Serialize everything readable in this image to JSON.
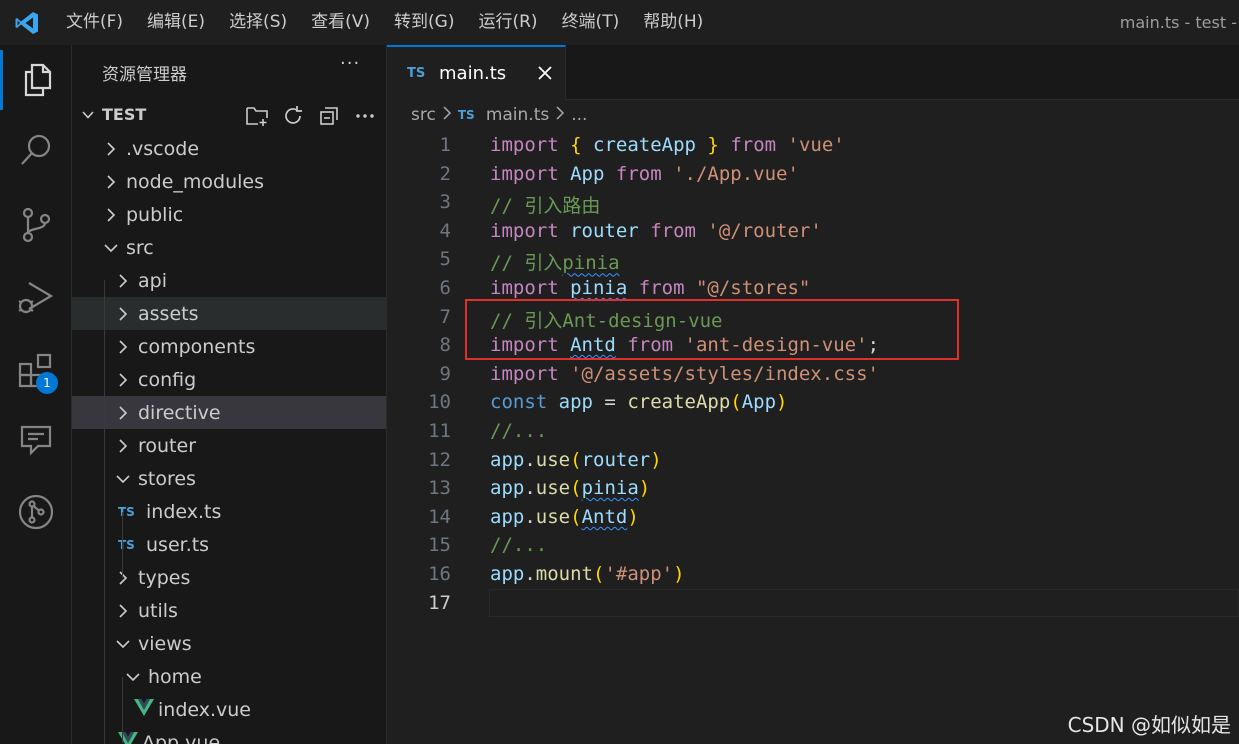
{
  "menu": [
    "文件(F)",
    "编辑(E)",
    "选择(S)",
    "查看(V)",
    "转到(G)",
    "运行(R)",
    "终端(T)",
    "帮助(H)"
  ],
  "window_title": "main.ts - test - V",
  "activity_bar": {
    "items": [
      "explorer",
      "search",
      "source-control",
      "run-debug",
      "extensions",
      "remote-explorer",
      "git-graph"
    ],
    "extensions_badge": "1"
  },
  "explorer": {
    "title": "资源管理器",
    "more": "···",
    "section": "TEST",
    "tree": [
      {
        "label": ".vscode",
        "kind": "folder",
        "open": false,
        "depth": 0
      },
      {
        "label": "node_modules",
        "kind": "folder",
        "open": false,
        "depth": 0
      },
      {
        "label": "public",
        "kind": "folder",
        "open": false,
        "depth": 0
      },
      {
        "label": "src",
        "kind": "folder",
        "open": true,
        "depth": 0
      },
      {
        "label": "api",
        "kind": "folder",
        "open": false,
        "depth": 1
      },
      {
        "label": "assets",
        "kind": "folder",
        "open": false,
        "depth": 1
      },
      {
        "label": "components",
        "kind": "folder",
        "open": false,
        "depth": 1
      },
      {
        "label": "config",
        "kind": "folder",
        "open": false,
        "depth": 1
      },
      {
        "label": "directive",
        "kind": "folder",
        "open": false,
        "depth": 1
      },
      {
        "label": "router",
        "kind": "folder",
        "open": false,
        "depth": 1
      },
      {
        "label": "stores",
        "kind": "folder",
        "open": true,
        "depth": 1
      },
      {
        "label": "index.ts",
        "kind": "ts",
        "depth": 2
      },
      {
        "label": "user.ts",
        "kind": "ts",
        "depth": 2
      },
      {
        "label": "types",
        "kind": "folder",
        "open": false,
        "depth": 1
      },
      {
        "label": "utils",
        "kind": "folder",
        "open": false,
        "depth": 1
      },
      {
        "label": "views",
        "kind": "folder",
        "open": true,
        "depth": 1
      },
      {
        "label": "home",
        "kind": "folder",
        "open": true,
        "depth": 2
      },
      {
        "label": "index.vue",
        "kind": "vue",
        "depth": 3
      },
      {
        "label": "App.vue",
        "kind": "vue",
        "depth": 1
      }
    ]
  },
  "tab": {
    "icon": "TS",
    "label": "main.ts"
  },
  "breadcrumb": {
    "folder": "src",
    "icon": "TS",
    "file": "main.ts",
    "more": "..."
  },
  "code_lines": [
    {
      "n": "1",
      "tokens": [
        [
          "import",
          "kw"
        ],
        [
          " ",
          "pl"
        ],
        [
          "{",
          "br1"
        ],
        [
          " ",
          "pl"
        ],
        [
          "createApp",
          "var"
        ],
        [
          " ",
          "pl"
        ],
        [
          "}",
          "br1"
        ],
        [
          " ",
          "pl"
        ],
        [
          "from",
          "kw"
        ],
        [
          " ",
          "pl"
        ],
        [
          "'vue'",
          "str"
        ]
      ]
    },
    {
      "n": "2",
      "tokens": [
        [
          "import",
          "kw"
        ],
        [
          " ",
          "pl"
        ],
        [
          "App",
          "var"
        ],
        [
          " ",
          "pl"
        ],
        [
          "from",
          "kw"
        ],
        [
          " ",
          "pl"
        ],
        [
          "'./App.vue'",
          "str"
        ]
      ]
    },
    {
      "n": "3",
      "tokens": [
        [
          "// 引入路由",
          "cmt"
        ]
      ]
    },
    {
      "n": "4",
      "tokens": [
        [
          "import",
          "kw"
        ],
        [
          " ",
          "pl"
        ],
        [
          "router",
          "var"
        ],
        [
          " ",
          "pl"
        ],
        [
          "from",
          "kw"
        ],
        [
          " ",
          "pl"
        ],
        [
          "'@/router'",
          "str"
        ]
      ]
    },
    {
      "n": "5",
      "tokens": [
        [
          "// 引入",
          "cmt"
        ],
        [
          "pinia",
          "cmt sq"
        ]
      ]
    },
    {
      "n": "6",
      "tokens": [
        [
          "import",
          "kw"
        ],
        [
          " ",
          "pl"
        ],
        [
          "pinia",
          "var sq"
        ],
        [
          " ",
          "pl"
        ],
        [
          "from",
          "kw"
        ],
        [
          " ",
          "pl"
        ],
        [
          "\"@/stores\"",
          "str"
        ]
      ]
    },
    {
      "n": "7",
      "tokens": [
        [
          "// 引入Ant-design-vue",
          "cmt"
        ]
      ]
    },
    {
      "n": "8",
      "tokens": [
        [
          "import",
          "kw"
        ],
        [
          " ",
          "pl"
        ],
        [
          "Antd",
          "var sq"
        ],
        [
          " ",
          "pl"
        ],
        [
          "from",
          "kw"
        ],
        [
          " ",
          "pl"
        ],
        [
          "'ant-design-vue'",
          "str"
        ],
        [
          ";",
          "pl"
        ]
      ]
    },
    {
      "n": "9",
      "tokens": [
        [
          "import",
          "kw"
        ],
        [
          " ",
          "pl"
        ],
        [
          "'@/assets/styles/index.css'",
          "str"
        ]
      ]
    },
    {
      "n": "10",
      "tokens": [
        [
          "const",
          "kwb"
        ],
        [
          " ",
          "pl"
        ],
        [
          "app",
          "var"
        ],
        [
          " = ",
          "pl"
        ],
        [
          "createApp",
          "fn"
        ],
        [
          "(",
          "br1"
        ],
        [
          "App",
          "var"
        ],
        [
          ")",
          "br1"
        ]
      ]
    },
    {
      "n": "11",
      "tokens": [
        [
          "//...",
          "cmt"
        ]
      ]
    },
    {
      "n": "12",
      "tokens": [
        [
          "app",
          "var"
        ],
        [
          ".",
          "pl"
        ],
        [
          "use",
          "fn"
        ],
        [
          "(",
          "br1"
        ],
        [
          "router",
          "var"
        ],
        [
          ")",
          "br1"
        ]
      ]
    },
    {
      "n": "13",
      "tokens": [
        [
          "app",
          "var"
        ],
        [
          ".",
          "pl"
        ],
        [
          "use",
          "fn"
        ],
        [
          "(",
          "br1"
        ],
        [
          "pinia",
          "var sq"
        ],
        [
          ")",
          "br1"
        ]
      ]
    },
    {
      "n": "14",
      "tokens": [
        [
          "app",
          "var"
        ],
        [
          ".",
          "pl"
        ],
        [
          "use",
          "fn"
        ],
        [
          "(",
          "br1"
        ],
        [
          "Antd",
          "var sq"
        ],
        [
          ")",
          "br1"
        ]
      ]
    },
    {
      "n": "15",
      "tokens": [
        [
          "//...",
          "cmt"
        ]
      ]
    },
    {
      "n": "16",
      "tokens": [
        [
          "app",
          "var"
        ],
        [
          ".",
          "pl"
        ],
        [
          "mount",
          "fn"
        ],
        [
          "(",
          "br1"
        ],
        [
          "'#app'",
          "str"
        ],
        [
          ")",
          "br1"
        ]
      ]
    },
    {
      "n": "17",
      "tokens": []
    }
  ],
  "current_line": "17",
  "highlight_box_color": "#e0302e",
  "watermark": "CSDN @如似如是"
}
